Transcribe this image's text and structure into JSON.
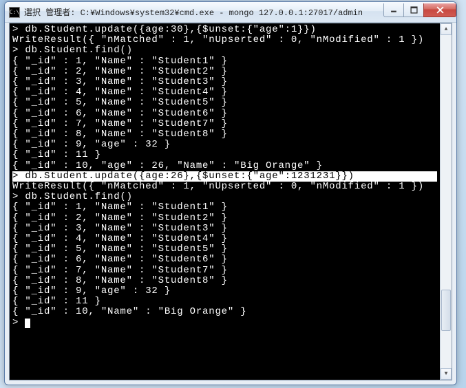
{
  "window": {
    "icon_text": "C:\\",
    "title": "選択 管理者: C:¥Windows¥system32¥cmd.exe - mongo  127.0.0.1:27017/admin"
  },
  "terminal": {
    "lines": [
      {
        "text": "> db.Student.update({age:30},{$unset:{\"age\":1}})",
        "highlighted": false
      },
      {
        "text": "WriteResult({ \"nMatched\" : 1, \"nUpserted\" : 0, \"nModified\" : 1 })",
        "highlighted": false
      },
      {
        "text": "> db.Student.find()",
        "highlighted": false
      },
      {
        "text": "{ \"_id\" : 1, \"Name\" : \"Student1\" }",
        "highlighted": false
      },
      {
        "text": "{ \"_id\" : 2, \"Name\" : \"Student2\" }",
        "highlighted": false
      },
      {
        "text": "{ \"_id\" : 3, \"Name\" : \"Student3\" }",
        "highlighted": false
      },
      {
        "text": "{ \"_id\" : 4, \"Name\" : \"Student4\" }",
        "highlighted": false
      },
      {
        "text": "{ \"_id\" : 5, \"Name\" : \"Student5\" }",
        "highlighted": false
      },
      {
        "text": "{ \"_id\" : 6, \"Name\" : \"Student6\" }",
        "highlighted": false
      },
      {
        "text": "{ \"_id\" : 7, \"Name\" : \"Student7\" }",
        "highlighted": false
      },
      {
        "text": "{ \"_id\" : 8, \"Name\" : \"Student8\" }",
        "highlighted": false
      },
      {
        "text": "{ \"_id\" : 9, \"age\" : 32 }",
        "highlighted": false
      },
      {
        "text": "{ \"_id\" : 11 }",
        "highlighted": false
      },
      {
        "text": "{ \"_id\" : 10, \"age\" : 26, \"Name\" : \"Big Orange\" }",
        "highlighted": false
      },
      {
        "text": "> db.Student.update({age:26},{$unset:{\"age\":1231231}})",
        "highlighted": true
      },
      {
        "text": "WriteResult({ \"nMatched\" : 1, \"nUpserted\" : 0, \"nModified\" : 1 })",
        "highlighted": false
      },
      {
        "text": "> db.Student.find()",
        "highlighted": false
      },
      {
        "text": "{ \"_id\" : 1, \"Name\" : \"Student1\" }",
        "highlighted": false
      },
      {
        "text": "{ \"_id\" : 2, \"Name\" : \"Student2\" }",
        "highlighted": false
      },
      {
        "text": "{ \"_id\" : 3, \"Name\" : \"Student3\" }",
        "highlighted": false
      },
      {
        "text": "{ \"_id\" : 4, \"Name\" : \"Student4\" }",
        "highlighted": false
      },
      {
        "text": "{ \"_id\" : 5, \"Name\" : \"Student5\" }",
        "highlighted": false
      },
      {
        "text": "{ \"_id\" : 6, \"Name\" : \"Student6\" }",
        "highlighted": false
      },
      {
        "text": "{ \"_id\" : 7, \"Name\" : \"Student7\" }",
        "highlighted": false
      },
      {
        "text": "{ \"_id\" : 8, \"Name\" : \"Student8\" }",
        "highlighted": false
      },
      {
        "text": "{ \"_id\" : 9, \"age\" : 32 }",
        "highlighted": false
      },
      {
        "text": "{ \"_id\" : 11 }",
        "highlighted": false
      },
      {
        "text": "{ \"_id\" : 10, \"Name\" : \"Big Orange\" }",
        "highlighted": false
      },
      {
        "text": "> ",
        "highlighted": false,
        "cursor": true
      }
    ]
  }
}
